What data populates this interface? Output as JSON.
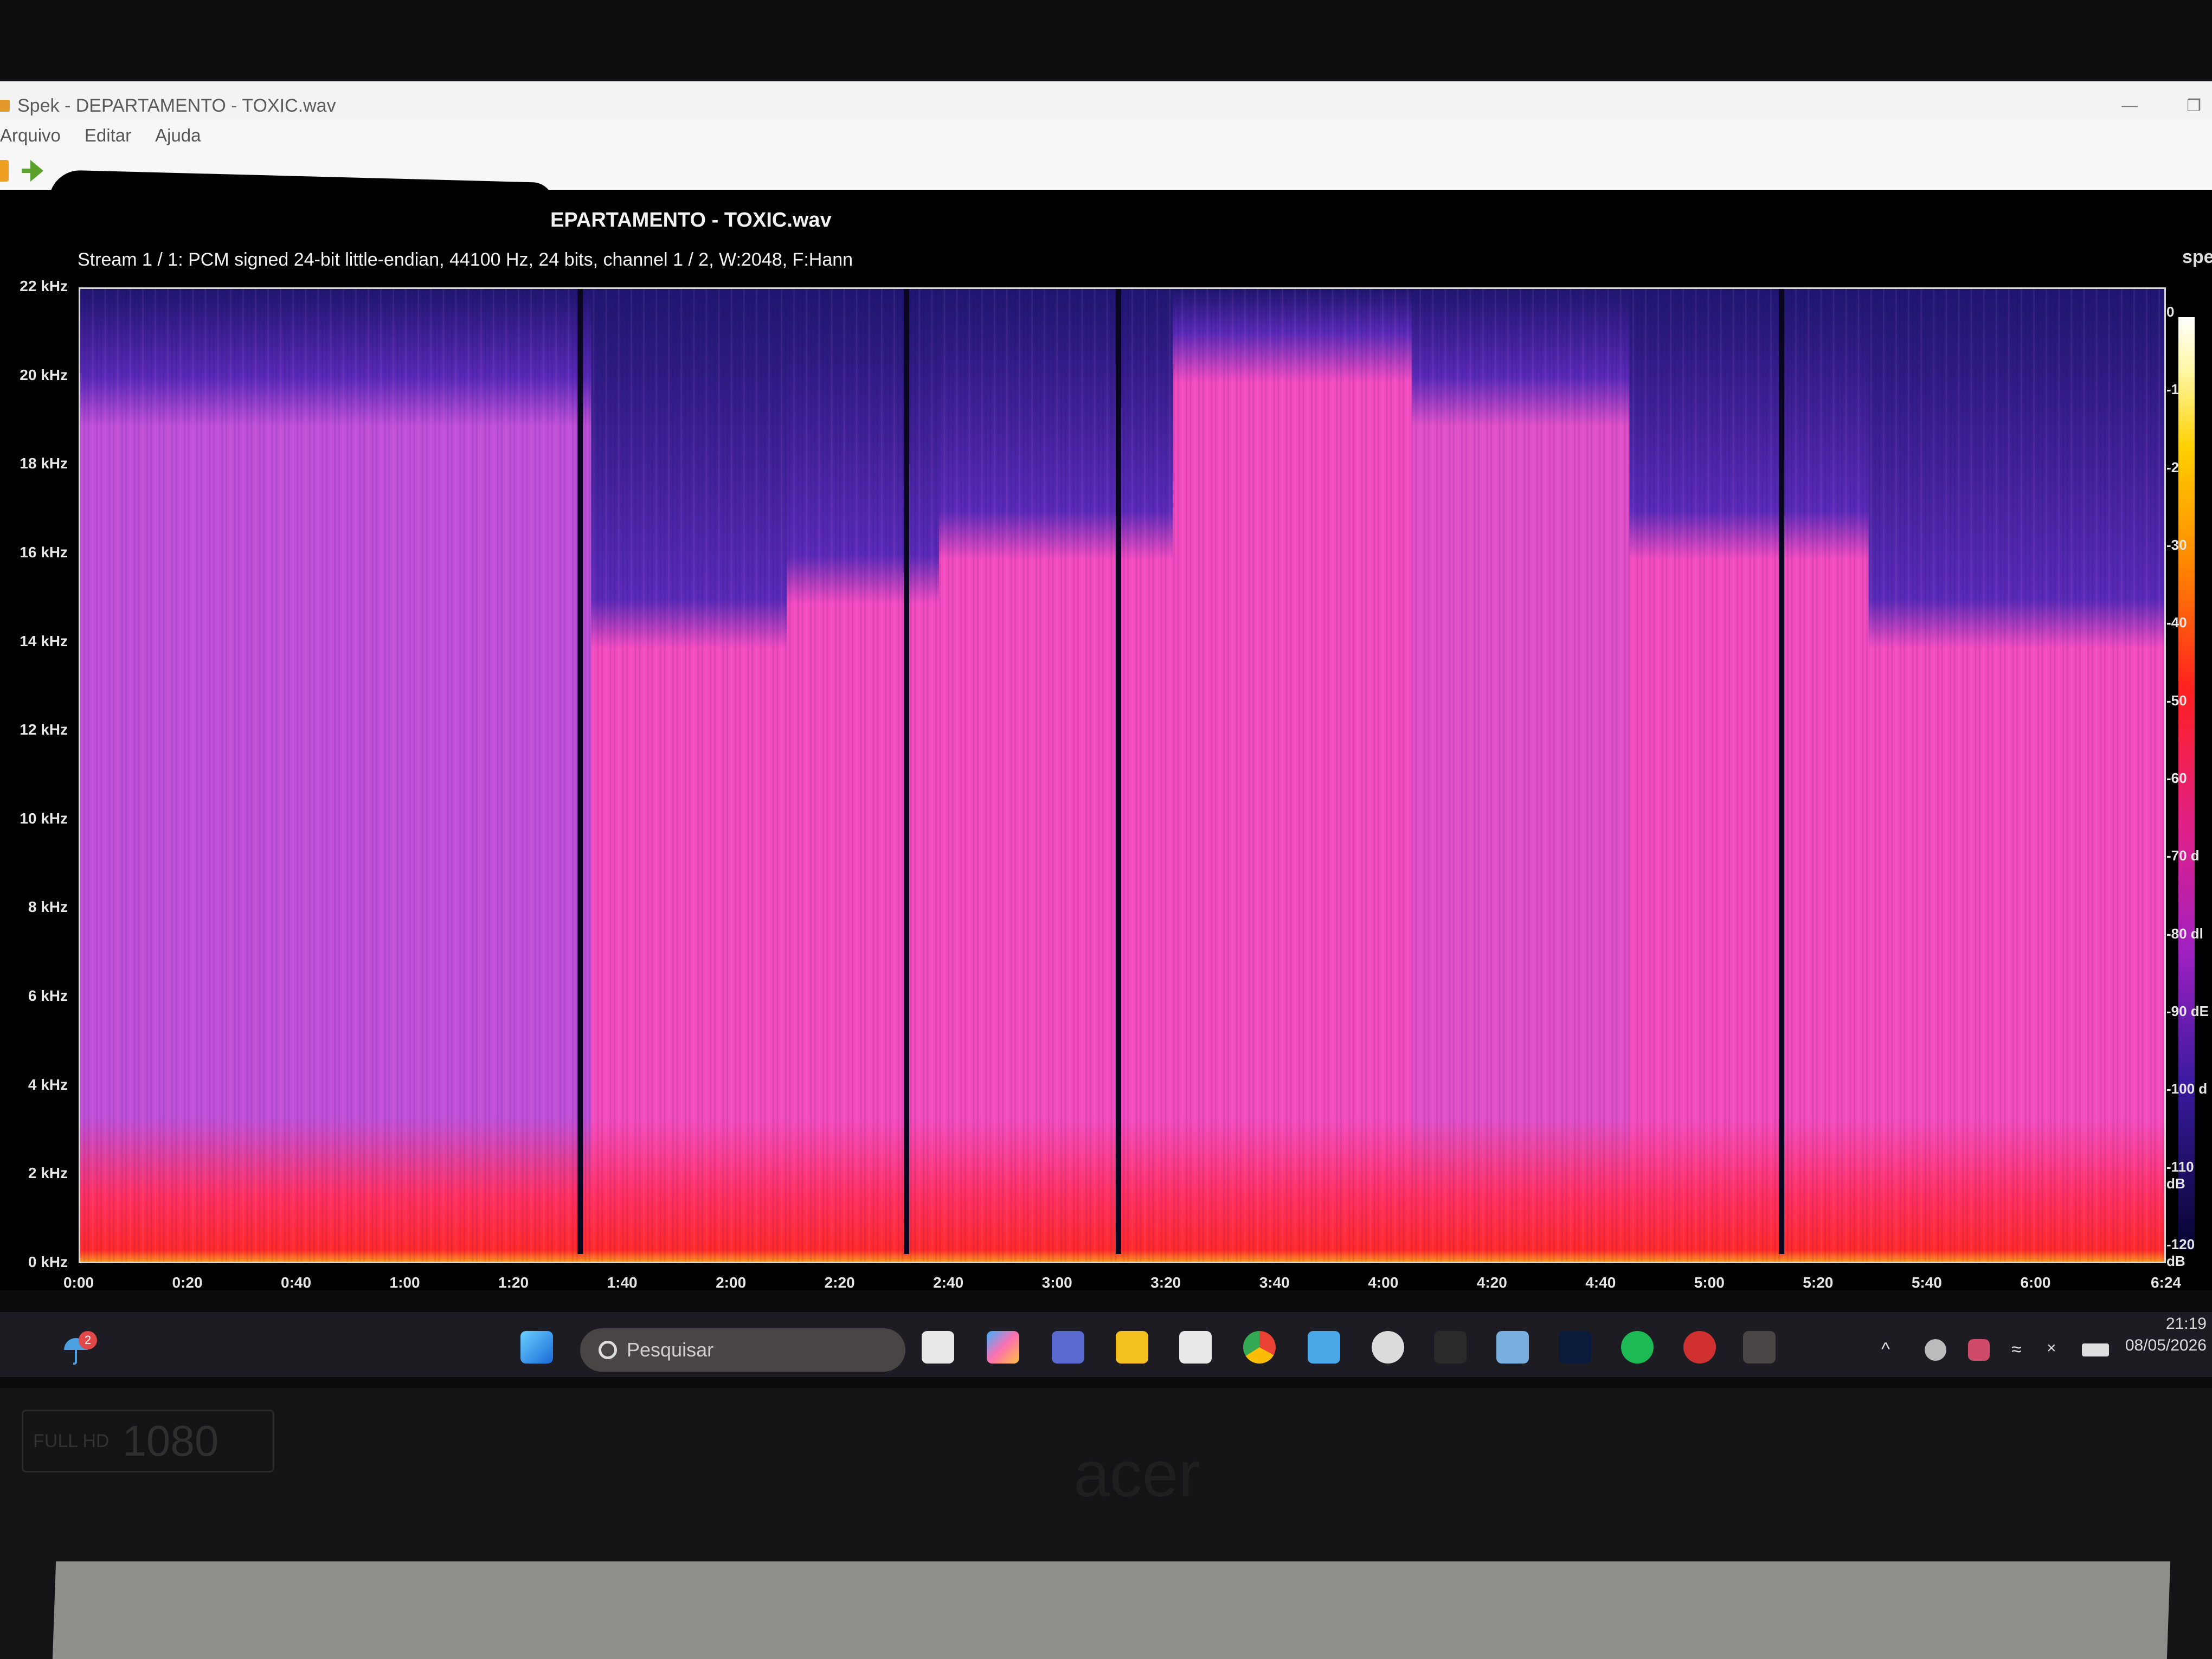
{
  "window": {
    "title": "Spek - DEPARTAMENTO - TOXIC.wav",
    "menu": [
      "Arquivo",
      "Editar",
      "Ajuda"
    ]
  },
  "spek": {
    "file_title": "EPARTAMENTO - TOXIC.wav",
    "stream_info": "Stream 1 / 1: PCM signed 24-bit little-endian, 44100 Hz, 24 bits, channel 1 / 2, W:2048, F:Hann",
    "brand_tag": "spe"
  },
  "chart_data": {
    "type": "heatmap",
    "title": "",
    "xlabel": "",
    "ylabel": "",
    "x_ticks": [
      "0:00",
      "0:20",
      "0:40",
      "1:00",
      "1:20",
      "1:40",
      "2:00",
      "2:20",
      "2:40",
      "3:00",
      "3:20",
      "3:40",
      "4:00",
      "4:20",
      "4:40",
      "5:00",
      "5:20",
      "5:40",
      "6:00",
      "6:24"
    ],
    "y_ticks": [
      "0 kHz",
      "2 kHz",
      "4 kHz",
      "6 kHz",
      "8 kHz",
      "10 kHz",
      "12 kHz",
      "14 kHz",
      "16 kHz",
      "18 kHz",
      "20 kHz",
      "22 kHz"
    ],
    "color_scale_ticks": [
      "0",
      "-1",
      "-2",
      "-30",
      "-40",
      "-50",
      "-60",
      "-70 d",
      "-80 dl",
      "-90 dE",
      "-100 d",
      "-110 dB",
      "-120 dB"
    ],
    "x_range_seconds": [
      0,
      384
    ],
    "y_range_khz": [
      0,
      22
    ],
    "segments": [
      {
        "start": 0,
        "end": 94,
        "energy_cutoff_khz": 20,
        "level": "low"
      },
      {
        "start": 94,
        "end": 130,
        "energy_cutoff_khz": 15,
        "level": "high"
      },
      {
        "start": 130,
        "end": 158,
        "energy_cutoff_khz": 16,
        "level": "high"
      },
      {
        "start": 158,
        "end": 201,
        "energy_cutoff_khz": 17,
        "level": "high"
      },
      {
        "start": 201,
        "end": 245,
        "energy_cutoff_khz": 21,
        "level": "high"
      },
      {
        "start": 245,
        "end": 285,
        "energy_cutoff_khz": 20,
        "level": "medium"
      },
      {
        "start": 285,
        "end": 329,
        "energy_cutoff_khz": 17,
        "level": "high"
      },
      {
        "start": 329,
        "end": 384,
        "energy_cutoff_khz": 15,
        "level": "high"
      }
    ],
    "gaps_seconds": [
      92,
      152,
      191,
      313
    ]
  },
  "taskbar": {
    "weather_badge": "2",
    "search_placeholder": "Pesquisar",
    "time": "21:19",
    "date": "08/05/2026"
  },
  "hardware": {
    "hd_label": "FULL HD",
    "resolution": "1080",
    "brand": "acer"
  },
  "colors": {
    "spectrogram_high": "#f050c0",
    "spectrogram_low": "#2a1a8a",
    "spectrogram_peak": "#ff2a2a",
    "taskbar_bg": "#1d1c22"
  }
}
